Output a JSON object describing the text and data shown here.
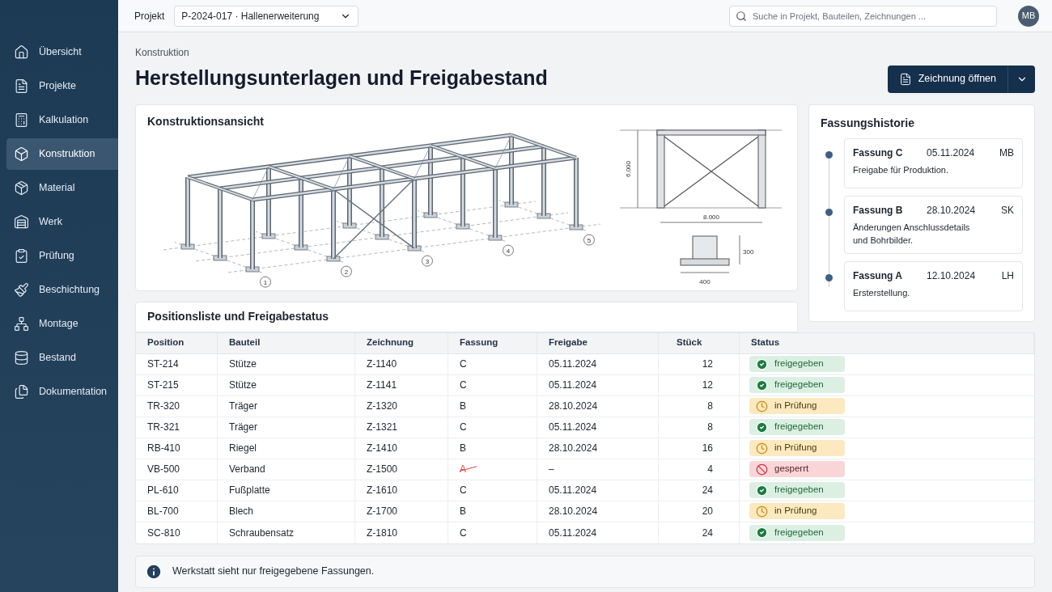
{
  "sidebar": {
    "items": [
      {
        "label": "Übersicht",
        "selected": false
      },
      {
        "label": "Projekte",
        "selected": false
      },
      {
        "label": "Kalkulation",
        "selected": false
      },
      {
        "label": "Konstruktion",
        "selected": true
      },
      {
        "label": "Material",
        "selected": false
      },
      {
        "label": "Werk",
        "selected": false
      },
      {
        "label": "Prüfung",
        "selected": false
      },
      {
        "label": "Beschichtung",
        "selected": false
      },
      {
        "label": "Montage",
        "selected": false
      },
      {
        "label": "Bestand",
        "selected": false
      },
      {
        "label": "Dokumentation",
        "selected": false
      }
    ]
  },
  "topbar": {
    "project_label": "Projekt",
    "project_value": "P-2024-017 · Hallenerweiterung",
    "search_placeholder": "Suche in Projekt, Bauteilen, Zeichnungen ...",
    "avatar": "MB"
  },
  "breadcrumb": "Konstruktion",
  "title": "Herstellungsunterlagen und Freigabestand",
  "primary_button": "Zeichnung öffnen",
  "drawing": {
    "title": "Konstruktionsansicht",
    "axis_labels": [
      "1",
      "2",
      "3",
      "4",
      "5"
    ],
    "height_dim": "6.000",
    "width_dim": "8.000",
    "plate_height_dim": "300",
    "plate_width_dim": "400"
  },
  "history": {
    "title": "Fassungshistorie",
    "entries": [
      {
        "name": "Fassung C",
        "date": "05.11.2024",
        "user": "MB",
        "note": "Freigabe für Produktion."
      },
      {
        "name": "Fassung B",
        "date": "28.10.2024",
        "user": "SK",
        "note": "Änderungen Anschlussdetails und Bohrbilder."
      },
      {
        "name": "Fassung A",
        "date": "12.10.2024",
        "user": "LH",
        "note": "Ersterstellung."
      }
    ]
  },
  "table": {
    "title": "Positionsliste und Freigabestatus",
    "columns": [
      "Position",
      "Bauteil",
      "Zeichnung",
      "Fassung",
      "Freigabe",
      "Stück",
      "Status"
    ],
    "rows": [
      {
        "position": "ST-214",
        "part": "Stütze",
        "drawing": "Z-1140",
        "revision": "C",
        "revision_struck": false,
        "release": "05.11.2024",
        "count": "12",
        "status": "freigegeben",
        "kind": "released"
      },
      {
        "position": "ST-215",
        "part": "Stütze",
        "drawing": "Z-1141",
        "revision": "C",
        "revision_struck": false,
        "release": "05.11.2024",
        "count": "12",
        "status": "freigegeben",
        "kind": "released"
      },
      {
        "position": "TR-320",
        "part": "Träger",
        "drawing": "Z-1320",
        "revision": "B",
        "revision_struck": false,
        "release": "28.10.2024",
        "count": "8",
        "status": "in Prüfung",
        "kind": "review"
      },
      {
        "position": "TR-321",
        "part": "Träger",
        "drawing": "Z-1321",
        "revision": "C",
        "revision_struck": false,
        "release": "05.11.2024",
        "count": "8",
        "status": "freigegeben",
        "kind": "released"
      },
      {
        "position": "RB-410",
        "part": "Riegel",
        "drawing": "Z-1410",
        "revision": "B",
        "revision_struck": false,
        "release": "28.10.2024",
        "count": "16",
        "status": "in Prüfung",
        "kind": "review"
      },
      {
        "position": "VB-500",
        "part": "Verband",
        "drawing": "Z-1500",
        "revision": "A",
        "revision_struck": true,
        "release": "–",
        "count": "4",
        "status": "gesperrt",
        "kind": "blocked"
      },
      {
        "position": "PL-610",
        "part": "Fußplatte",
        "drawing": "Z-1610",
        "revision": "C",
        "revision_struck": false,
        "release": "05.11.2024",
        "count": "24",
        "status": "freigegeben",
        "kind": "released"
      },
      {
        "position": "BL-700",
        "part": "Blech",
        "drawing": "Z-1700",
        "revision": "B",
        "revision_struck": false,
        "release": "28.10.2024",
        "count": "20",
        "status": "in Prüfung",
        "kind": "review"
      },
      {
        "position": "SC-810",
        "part": "Schraubensatz",
        "drawing": "Z-1810",
        "revision": "C",
        "revision_struck": false,
        "release": "05.11.2024",
        "count": "24",
        "status": "freigegeben",
        "kind": "released"
      }
    ]
  },
  "info": "Werkstatt sieht nur freigegebene Fassungen."
}
